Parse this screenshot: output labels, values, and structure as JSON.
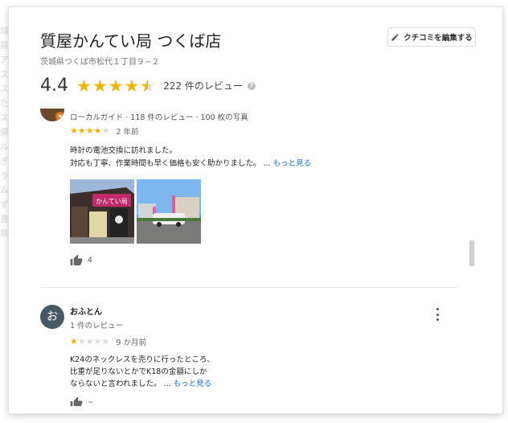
{
  "place": {
    "title": "質屋かんてい局 つくば店",
    "address": "茨城県つくば市松代１丁目９−２",
    "rating": "4.4",
    "rating_value": 4.4,
    "review_count": "222 件のレビュー"
  },
  "toolbar": {
    "write_review_label": "クチコミを編集する"
  },
  "reviews": [
    {
      "meta": "ローカルガイド · 118 件のレビュー · 100 枚の写真",
      "stars": 4,
      "age": "2 年前",
      "line1": "時計の電池交換に訪れました。",
      "line2": "対応も丁寧、作業時間も早く価格も安く助かりました。 ...",
      "more": "もっと見る",
      "likes": "4",
      "photo_sign": "かんてい局"
    },
    {
      "avatar_letter": "お",
      "name": "おふとん",
      "review_count": "1 件のレビュー",
      "stars": 1,
      "age": "9 か月前",
      "line1": "K24のネックレスを売りに行ったところ、",
      "line2": "比重が足りないとかでK18の金額にしか",
      "line3": "ならないと言われました。 ...",
      "more": "もっと見る",
      "likes": "~"
    }
  ],
  "colors": {
    "star": "#f4b400",
    "link": "#1a73e8",
    "avatar2": "#455a64"
  },
  "icons": [
    "pencil-icon",
    "help-icon",
    "star-icon",
    "thumb-up-icon",
    "more-vert-icon"
  ]
}
